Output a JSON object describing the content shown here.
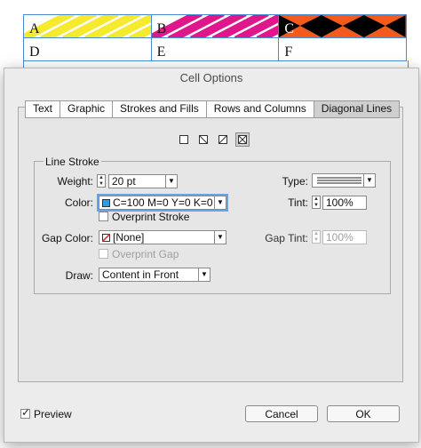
{
  "table": {
    "row1": [
      "A",
      "B",
      "C"
    ],
    "row2": [
      "D",
      "E",
      "F"
    ],
    "colors": {
      "yellow": "#f5ea2e",
      "magenta": "#e0168c",
      "orange": "#f25a1e",
      "black": "#000000",
      "border": "#4a8bd0"
    }
  },
  "dialog": {
    "title": "Cell Options",
    "tabs": [
      "Text",
      "Graphic",
      "Strokes and Fills",
      "Rows and Columns",
      "Diagonal Lines"
    ],
    "active_tab": "Diagonal Lines",
    "line_stroke": {
      "group_label": "Line Stroke",
      "weight_label": "Weight:",
      "weight_value": "20 pt",
      "type_label": "Type:",
      "color_label": "Color:",
      "color_value": "C=100 M=0 Y=0 K=0",
      "color_swatch": "#2a9ee0",
      "tint_label": "Tint:",
      "tint_value": "100%",
      "overprint_stroke_label": "Overprint Stroke",
      "gap_color_label": "Gap Color:",
      "gap_color_value": "[None]",
      "gap_tint_label": "Gap Tint:",
      "gap_tint_value": "100%",
      "overprint_gap_label": "Overprint Gap"
    },
    "draw_label": "Draw:",
    "draw_value": "Content in Front",
    "preview_label": "Preview",
    "cancel_label": "Cancel",
    "ok_label": "OK"
  }
}
